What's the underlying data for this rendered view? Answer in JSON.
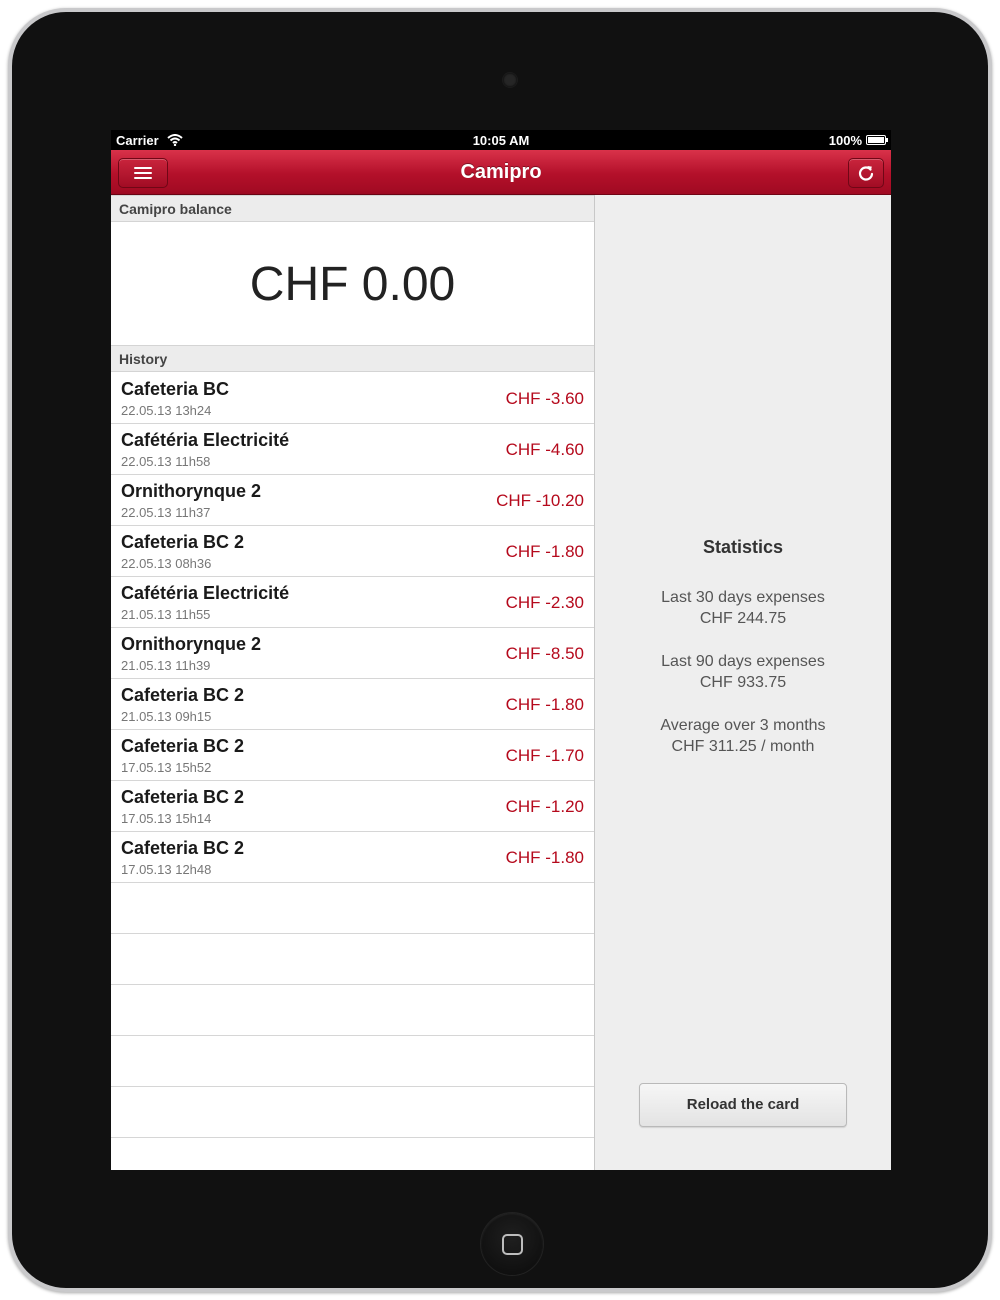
{
  "status_bar": {
    "carrier": "Carrier",
    "time": "10:05 AM",
    "battery": "100%"
  },
  "nav": {
    "title": "Camipro",
    "menu_icon": "menu-icon",
    "refresh_icon": "refresh-icon"
  },
  "balance": {
    "header": "Camipro balance",
    "value": "CHF 0.00"
  },
  "history": {
    "header": "History",
    "items": [
      {
        "title": "Cafeteria BC",
        "date": "22.05.13 13h24",
        "amount": "CHF -3.60"
      },
      {
        "title": "Cafétéria Electricité",
        "date": "22.05.13 11h58",
        "amount": "CHF -4.60"
      },
      {
        "title": "Ornithorynque 2",
        "date": "22.05.13 11h37",
        "amount": "CHF -10.20"
      },
      {
        "title": "Cafeteria BC 2",
        "date": "22.05.13 08h36",
        "amount": "CHF -1.80"
      },
      {
        "title": "Cafétéria Electricité",
        "date": "21.05.13 11h55",
        "amount": "CHF -2.30"
      },
      {
        "title": "Ornithorynque 2",
        "date": "21.05.13 11h39",
        "amount": "CHF -8.50"
      },
      {
        "title": "Cafeteria BC 2",
        "date": "21.05.13 09h15",
        "amount": "CHF -1.80"
      },
      {
        "title": "Cafeteria BC 2",
        "date": "17.05.13 15h52",
        "amount": "CHF -1.70"
      },
      {
        "title": "Cafeteria BC 2",
        "date": "17.05.13 15h14",
        "amount": "CHF -1.20"
      },
      {
        "title": "Cafeteria BC 2",
        "date": "17.05.13 12h48",
        "amount": "CHF -1.80"
      }
    ]
  },
  "statistics": {
    "title": "Statistics",
    "last30_label": "Last 30 days expenses",
    "last30_value": "CHF 244.75",
    "last90_label": "Last 90 days expenses",
    "last90_value": "CHF 933.75",
    "avg_label": "Average over 3 months",
    "avg_value": "CHF 311.25 / month"
  },
  "reload_button": "Reload the card",
  "colors": {
    "nav_red": "#b3102a",
    "amount_red": "#b5091c"
  }
}
